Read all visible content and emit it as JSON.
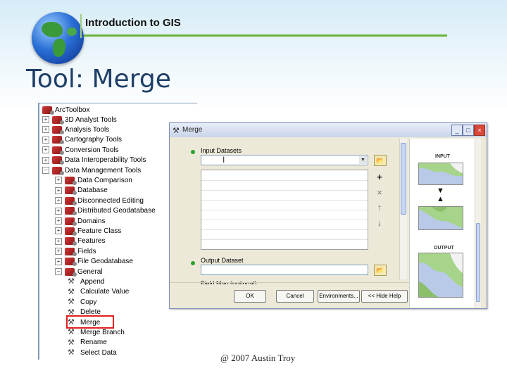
{
  "header": {
    "course_title": "Introduction to GIS"
  },
  "slide": {
    "title": "Tool: Merge",
    "footer": "@ 2007 Austin Troy"
  },
  "toolbox": {
    "root_label": "ArcToolbox",
    "items": [
      {
        "label": "3D Analyst Tools",
        "kind": "toolbox",
        "expander": "+"
      },
      {
        "label": "Analysis Tools",
        "kind": "toolbox",
        "expander": "+"
      },
      {
        "label": "Cartography Tools",
        "kind": "toolbox",
        "expander": "+"
      },
      {
        "label": "Conversion Tools",
        "kind": "toolbox",
        "expander": "+"
      },
      {
        "label": "Data Interoperability Tools",
        "kind": "toolbox",
        "expander": "+"
      },
      {
        "label": "Data Management Tools",
        "kind": "toolbox",
        "expander": "−"
      },
      {
        "label": "Data Comparison",
        "kind": "toolset",
        "expander": "+"
      },
      {
        "label": "Database",
        "kind": "toolset",
        "expander": "+"
      },
      {
        "label": "Disconnected Editing",
        "kind": "toolset",
        "expander": "+"
      },
      {
        "label": "Distributed Geodatabase",
        "kind": "toolset",
        "expander": "+"
      },
      {
        "label": "Domains",
        "kind": "toolset",
        "expander": "+"
      },
      {
        "label": "Feature Class",
        "kind": "toolset",
        "expander": "+"
      },
      {
        "label": "Features",
        "kind": "toolset",
        "expander": "+"
      },
      {
        "label": "Fields",
        "kind": "toolset",
        "expander": "+"
      },
      {
        "label": "File Geodatabase",
        "kind": "toolset",
        "expander": "+"
      },
      {
        "label": "General",
        "kind": "toolset",
        "expander": "−"
      },
      {
        "label": "Append",
        "kind": "tool"
      },
      {
        "label": "Calculate Value",
        "kind": "tool"
      },
      {
        "label": "Copy",
        "kind": "tool"
      },
      {
        "label": "Delete",
        "kind": "tool"
      },
      {
        "label": "Merge",
        "kind": "tool",
        "selected": true
      },
      {
        "label": "Merge Branch",
        "kind": "tool"
      },
      {
        "label": "Rename",
        "kind": "tool"
      },
      {
        "label": "Select Data",
        "kind": "tool"
      }
    ],
    "highlight_color": "#e02020"
  },
  "dialog": {
    "title": "Merge",
    "minimize_icon": "minimize-icon",
    "maximize_icon": "maximize-icon",
    "close_icon": "close-icon",
    "input_label": "Input Datasets",
    "input_value": "",
    "output_label": "Output Dataset",
    "output_value": "",
    "field_map_label": "Field Map (optional)",
    "side_buttons": [
      {
        "icon": "add-icon",
        "glyph": "+"
      },
      {
        "icon": "remove-icon",
        "glyph": "×"
      },
      {
        "icon": "move-up-icon",
        "glyph": "↑"
      },
      {
        "icon": "move-down-icon",
        "glyph": "↓"
      }
    ],
    "buttons": {
      "ok": "OK",
      "cancel": "Cancel",
      "environments": "Environments...",
      "hide_help": "<< Hide Help"
    },
    "help": {
      "input_heading": "INPUT",
      "output_heading": "OUTPUT"
    }
  }
}
